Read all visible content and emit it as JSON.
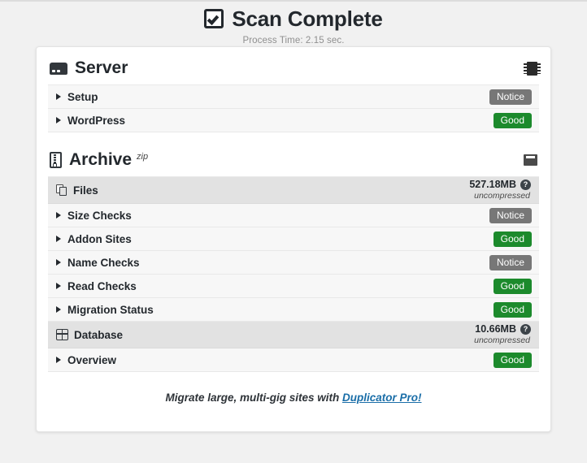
{
  "header": {
    "title": "Scan Complete",
    "subtitle": "Process Time: 2.15 sec.",
    "check_icon": "checkbox-checked-icon"
  },
  "sections": [
    {
      "id": "server",
      "title": "Server",
      "icon": "hdd-icon",
      "corner_icon": "microchip-icon",
      "rows": [
        {
          "label": "Setup",
          "status": "Notice",
          "status_kind": "notice"
        },
        {
          "label": "WordPress",
          "status": "Good",
          "status_kind": "good"
        }
      ]
    },
    {
      "id": "archive",
      "title": "Archive",
      "superscript": "zip",
      "icon": "file-zip-icon",
      "corner_icon": "save-icon",
      "groups": [
        {
          "label": "Files",
          "icon": "copy-icon",
          "size": "527.18MB",
          "size_note": "uncompressed",
          "help_icon": "help-circle-icon",
          "rows": [
            {
              "label": "Size Checks",
              "status": "Notice",
              "status_kind": "notice"
            },
            {
              "label": "Addon Sites",
              "status": "Good",
              "status_kind": "good"
            },
            {
              "label": "Name Checks",
              "status": "Notice",
              "status_kind": "notice"
            },
            {
              "label": "Read Checks",
              "status": "Good",
              "status_kind": "good"
            },
            {
              "label": "Migration Status",
              "status": "Good",
              "status_kind": "good"
            }
          ]
        },
        {
          "label": "Database",
          "icon": "table-icon",
          "size": "10.66MB",
          "size_note": "uncompressed",
          "help_icon": "help-circle-icon",
          "rows": [
            {
              "label": "Overview",
              "status": "Good",
              "status_kind": "good"
            }
          ]
        }
      ]
    }
  ],
  "footer": {
    "text": "Migrate large, multi-gig sites with ",
    "link_label": "Duplicator Pro!"
  },
  "colors": {
    "good": "#1c8a2c",
    "notice": "#777777",
    "link": "#1a6ea8",
    "page_bg": "#f1f1f1",
    "row_bg": "#f7f7f7",
    "group_bg": "#e2e2e2"
  },
  "help_glyph": "?"
}
